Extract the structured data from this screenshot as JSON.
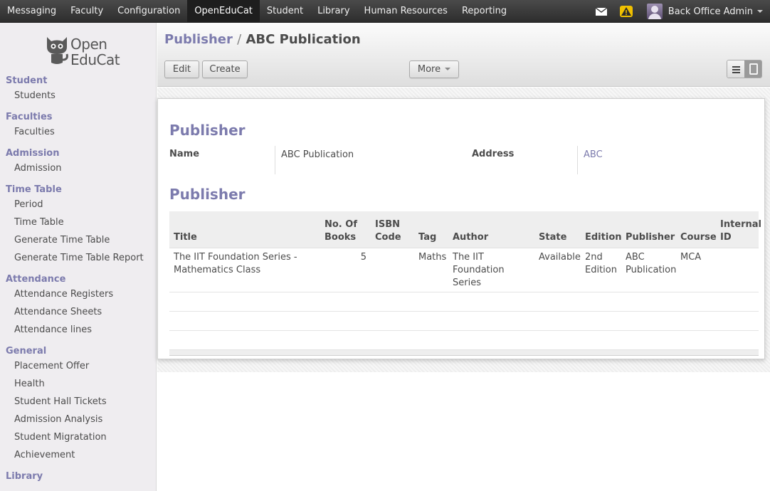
{
  "topbar": {
    "menu": [
      "Messaging",
      "Faculty",
      "Configuration",
      "OpenEduCat",
      "Student",
      "Library",
      "Human Resources",
      "Reporting"
    ],
    "active_index": 3,
    "user_name": "Back Office Admin",
    "icons": [
      "envelope-icon",
      "warning-icon",
      "avatar"
    ]
  },
  "sidebar": {
    "logo": {
      "line1": "Open",
      "line2": "EduCat"
    },
    "sections": [
      {
        "title": "Student",
        "items": [
          "Students"
        ]
      },
      {
        "title": "Faculties",
        "items": [
          "Faculties"
        ]
      },
      {
        "title": "Admission",
        "items": [
          "Admission"
        ]
      },
      {
        "title": "Time Table",
        "items": [
          "Period",
          "Time Table",
          "Generate Time Table",
          "Generate Time Table Report"
        ]
      },
      {
        "title": "Attendance",
        "items": [
          "Attendance Registers",
          "Attendance Sheets",
          "Attendance lines"
        ]
      },
      {
        "title": "General",
        "items": [
          "Placement Offer",
          "Health",
          "Student Hall Tickets",
          "Admission Analysis",
          "Student Migratation",
          "Achievement"
        ]
      },
      {
        "title": "Library",
        "items": []
      }
    ]
  },
  "breadcrumb": {
    "parent": "Publisher",
    "separator": "/",
    "current": "ABC Publication"
  },
  "buttons": {
    "edit": "Edit",
    "create": "Create",
    "more": "More"
  },
  "form": {
    "section1_title": "Publisher",
    "name_label": "Name",
    "name_value": "ABC Publication",
    "address_label": "Address",
    "address_value": "ABC",
    "section2_title": "Publisher"
  },
  "table": {
    "headers": [
      "Title",
      "No. Of Books",
      "ISBN Code",
      "Tag",
      "Author",
      "State",
      "Edition",
      "Publisher",
      "Course",
      "Internal ID"
    ],
    "rows": [
      {
        "title": "The IIT Foundation Series - Mathematics Class",
        "no_of_books": "5",
        "isbn_code": "",
        "tag": "Maths",
        "author": "The IIT Foundation Series",
        "state": "Available",
        "edition": "2nd Edition",
        "publisher": "ABC Publication",
        "course": "MCA",
        "internal_id": ""
      }
    ]
  },
  "colors": {
    "accent": "#7c7bad",
    "topbar": "#3a3a3a",
    "sidebar": "#efedf0"
  }
}
